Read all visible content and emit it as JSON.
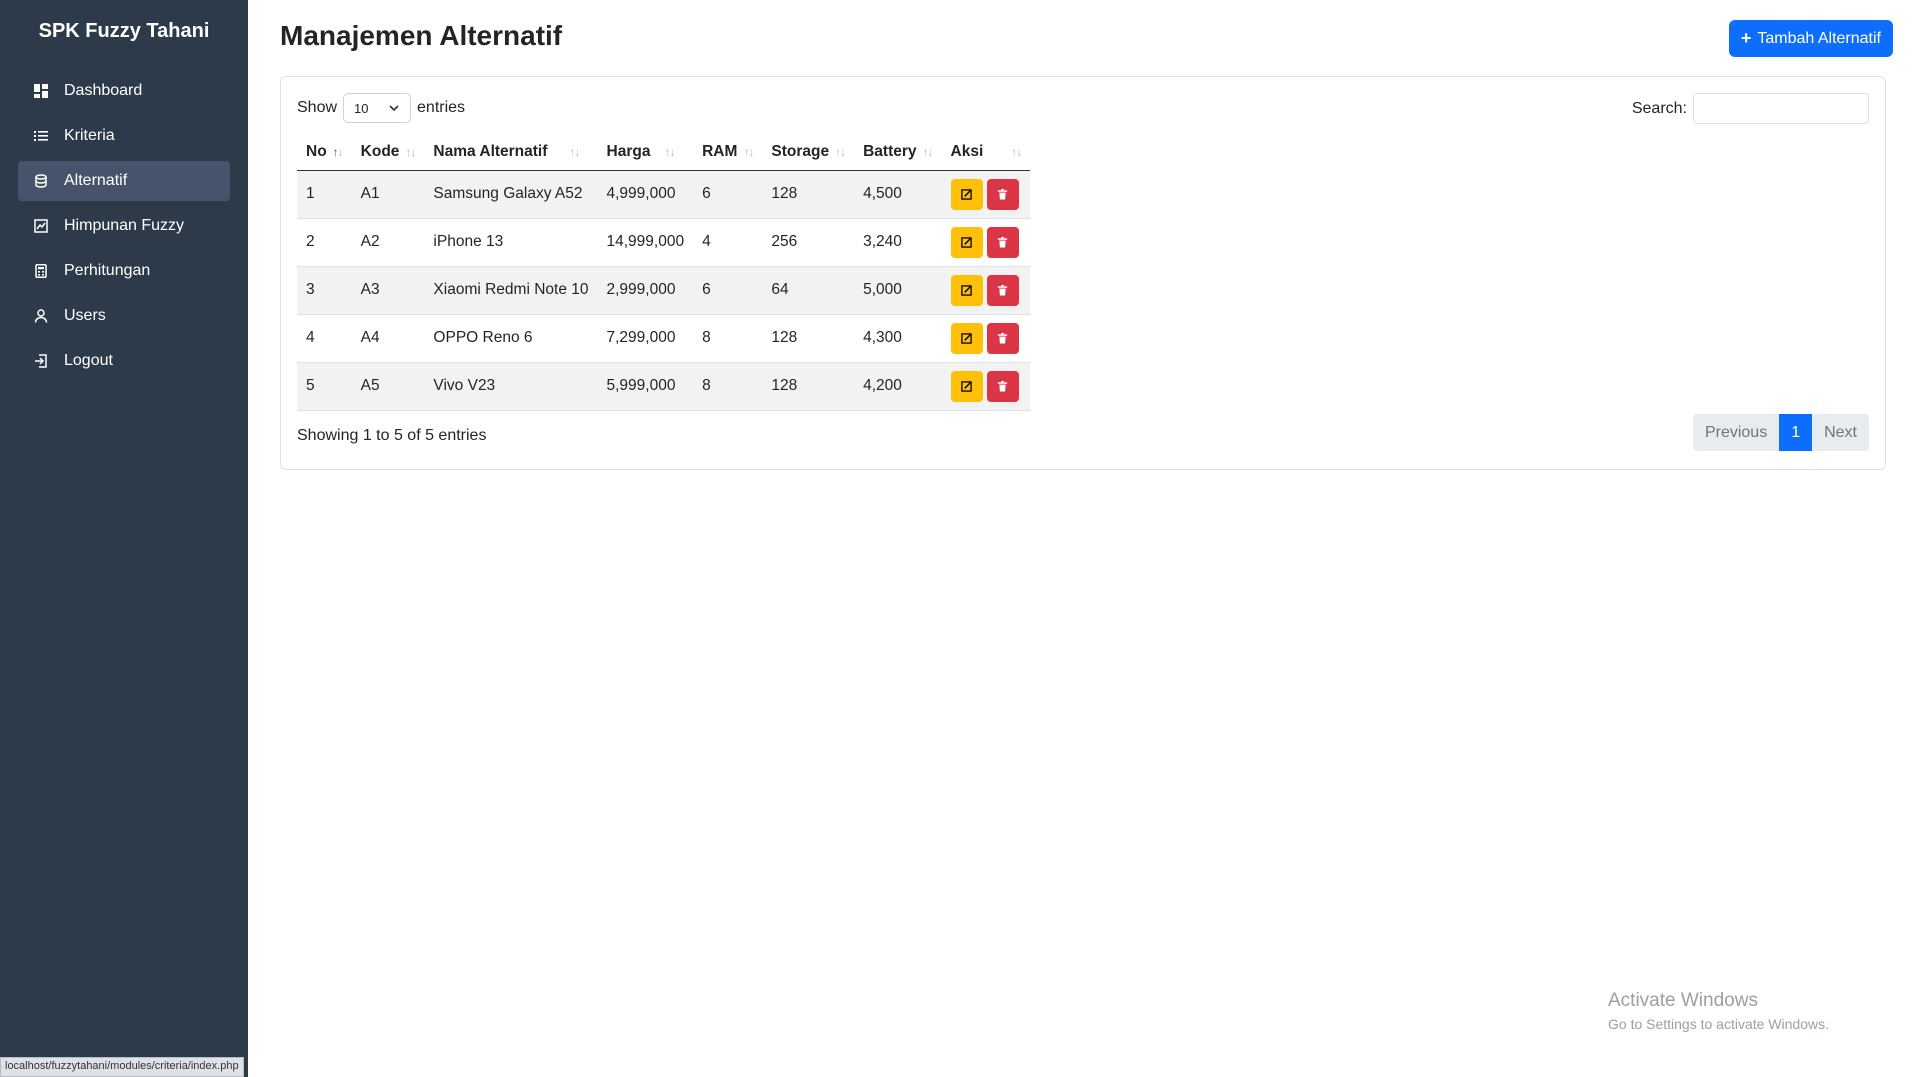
{
  "sidebar": {
    "brand": "SPK Fuzzy Tahani",
    "items": [
      {
        "label": "Dashboard",
        "icon": "dashboard-icon",
        "active": false
      },
      {
        "label": "Kriteria",
        "icon": "list-icon",
        "active": false
      },
      {
        "label": "Alternatif",
        "icon": "database-icon",
        "active": true
      },
      {
        "label": "Himpunan Fuzzy",
        "icon": "chart-box-icon",
        "active": false
      },
      {
        "label": "Perhitungan",
        "icon": "calculator-icon",
        "active": false
      },
      {
        "label": "Users",
        "icon": "user-icon",
        "active": false
      },
      {
        "label": "Logout",
        "icon": "logout-icon",
        "active": false
      }
    ]
  },
  "header": {
    "title": "Manajemen Alternatif",
    "add_button": "Tambah Alternatif"
  },
  "table_controls": {
    "show_label": "Show",
    "entries_value": "10",
    "entries_label": "entries",
    "search_label": "Search:",
    "search_value": ""
  },
  "table": {
    "columns": [
      "No",
      "Kode",
      "Nama Alternatif",
      "Harga",
      "RAM",
      "Storage",
      "Battery",
      "Aksi"
    ],
    "rows": [
      [
        "1",
        "A1",
        "Samsung Galaxy A52",
        "4,999,000",
        "6",
        "128",
        "4,500"
      ],
      [
        "2",
        "A2",
        "iPhone 13",
        "14,999,000",
        "4",
        "256",
        "3,240"
      ],
      [
        "3",
        "A3",
        "Xiaomi Redmi Note 10",
        "2,999,000",
        "6",
        "64",
        "5,000"
      ],
      [
        "4",
        "A4",
        "OPPO Reno 6",
        "7,299,000",
        "8",
        "128",
        "4,300"
      ],
      [
        "5",
        "A5",
        "Vivo V23",
        "5,999,000",
        "8",
        "128",
        "4,200"
      ]
    ]
  },
  "footer": {
    "info": "Showing 1 to 5 of 5 entries",
    "previous": "Previous",
    "page": "1",
    "next": "Next"
  },
  "watermark": {
    "line1": "Activate Windows",
    "line2": "Go to Settings to activate Windows."
  },
  "status_url": "localhost/fuzzytahani/modules/criteria/index.php",
  "colors": {
    "sidebar_bg": "#2d3a4a",
    "primary": "#0d6efd",
    "edit": "#ffc107",
    "delete": "#dc3545"
  }
}
